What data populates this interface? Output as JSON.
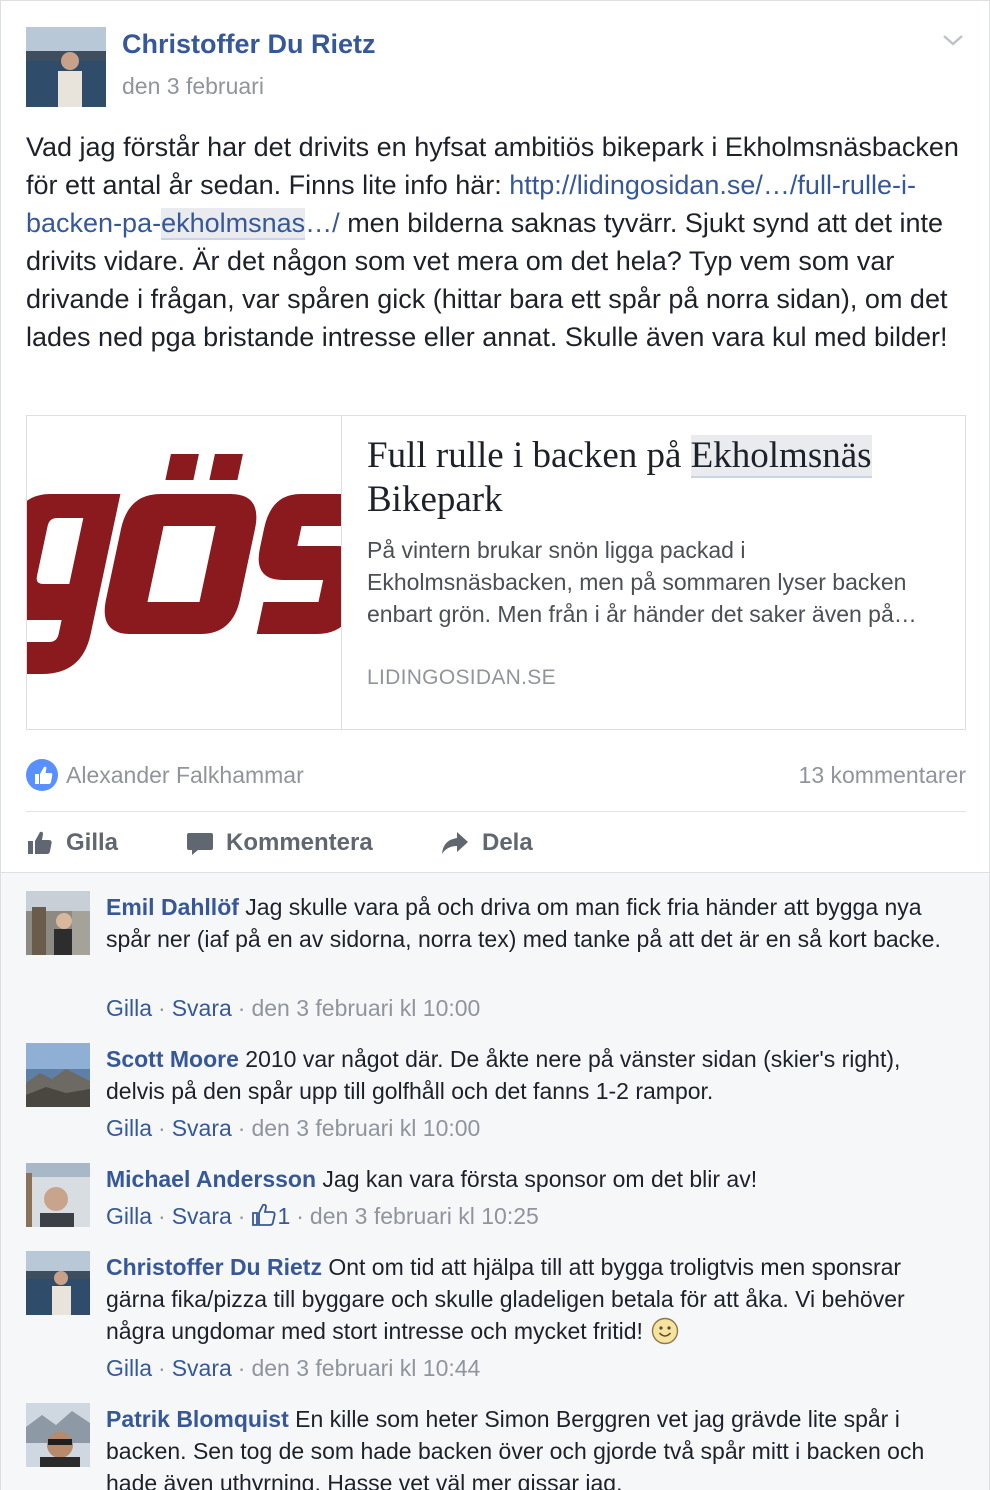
{
  "post": {
    "author": "Christoffer Du Rietz",
    "date": "den 3 februari",
    "text_1": "Vad jag förstår har det drivits en hyfsat ambitiös bikepark i Ekholmsnäsbacken för ett antal år sedan. Finns lite info här: ",
    "link_1": "http://lidingosidan.se/…/full-rulle-i-backen-pa-",
    "link_hl": "ekholmsnas",
    "link_2": "…/",
    "text_2": " men bilderna saknas tyvärr. Sjukt synd att det inte drivits vidare. Är det någon som vet mera om det hela? Typ vem som var drivande i frågan, var spåren gick (hittar bara ett spår på norra sidan), om det lades ned pga bristande intresse eller annat. Skulle även vara kul med bilder!"
  },
  "link_card": {
    "title_1": "Full rulle i backen på ",
    "title_hl": "Ekholmsnäs",
    "title_2": " Bikepark",
    "description": "På vintern brukar snön ligga packad i Ekholmsnäsbacken, men på sommaren lyser backen enbart grön. Men från i år händer det saker även på…",
    "domain": "LIDINGOSIDAN.SE",
    "image_text": "gös"
  },
  "reactions": {
    "likers": "Alexander Falkhammar",
    "comment_count": "13 kommentarer"
  },
  "actions": {
    "like": "Gilla",
    "comment": "Kommentera",
    "share": "Dela"
  },
  "comments": [
    {
      "name": "Emil Dahllöf",
      "text": " Jag skulle vara på och driva om man fick fria händer att bygga nya spår ner (iaf på en av sidorna, norra tex) med tanke på att det är en så kort backe.",
      "like": "Gilla",
      "reply": "Svara",
      "time": "den 3 februari kl 10:00"
    },
    {
      "name": "Scott Moore",
      "text": " 2010 var något där. De åkte nere på vänster sidan (skier's right), delvis på den spår upp till golfhåll och det fanns 1-2 rampor.",
      "like": "Gilla",
      "reply": "Svara",
      "time": "den 3 februari kl 10:00"
    },
    {
      "name": "Michael Andersson",
      "text": " Jag kan vara första sponsor om det blir av!",
      "like": "Gilla",
      "reply": "Svara",
      "likes": "1",
      "time": "den 3 februari kl 10:25"
    },
    {
      "name": "Christoffer Du Rietz",
      "text": " Ont om tid att hjälpa till att bygga troligtvis men sponsrar gärna fika/pizza till byggare och skulle gladeligen betala för att åka. Vi behöver några ungdomar med stort intresse och mycket fritid!",
      "like": "Gilla",
      "reply": "Svara",
      "time": "den 3 februari kl 10:44"
    },
    {
      "name": "Patrik Blomquist",
      "text": " En kille som heter Simon Berggren vet jag grävde lite spår i backen. Sen tog de som hade backen över och gjorde två spår mitt i backen och hade även uthyrning. Hasse vet väl mer gissar jag."
    }
  ],
  "colors": {
    "link_blue": "#365899",
    "meta_gray": "#90949c",
    "like_blue": "#5890ff",
    "comments_bg": "#f6f7f9",
    "logo_red": "#8b1a1e"
  }
}
